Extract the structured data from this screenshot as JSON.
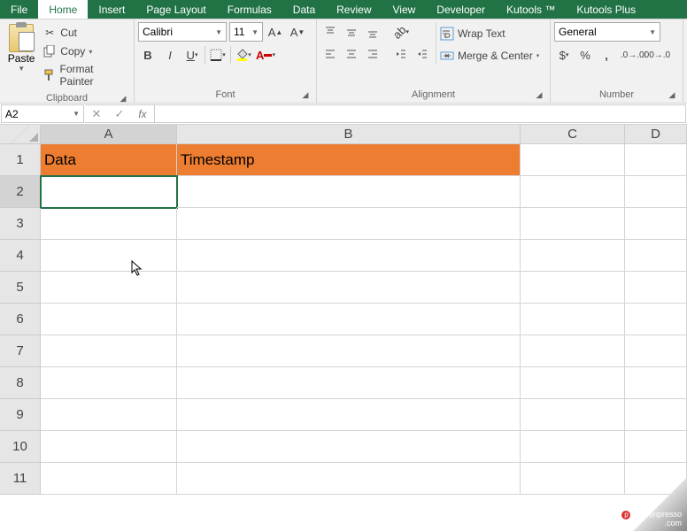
{
  "tabs": [
    "File",
    "Home",
    "Insert",
    "Page Layout",
    "Formulas",
    "Data",
    "Review",
    "View",
    "Developer",
    "Kutools ™",
    "Kutools Plus"
  ],
  "active_tab": "Home",
  "clipboard": {
    "paste": "Paste",
    "cut": "Cut",
    "copy": "Copy",
    "format_painter": "Format Painter",
    "group": "Clipboard"
  },
  "font": {
    "name": "Calibri",
    "size": "11",
    "group": "Font"
  },
  "alignment": {
    "wrap": "Wrap Text",
    "merge": "Merge & Center",
    "group": "Alignment"
  },
  "number": {
    "format": "General",
    "group": "Number"
  },
  "namebox": "A2",
  "columns": [
    "A",
    "B",
    "C",
    "D"
  ],
  "rows": [
    "1",
    "2",
    "3",
    "4",
    "5",
    "6",
    "7",
    "8",
    "9",
    "10",
    "11"
  ],
  "cells": {
    "A1": "Data",
    "B1": "Timestamp"
  },
  "selected_cell": "A2",
  "watermark": {
    "brand": "Screenpresso",
    "suffix": ".com"
  }
}
